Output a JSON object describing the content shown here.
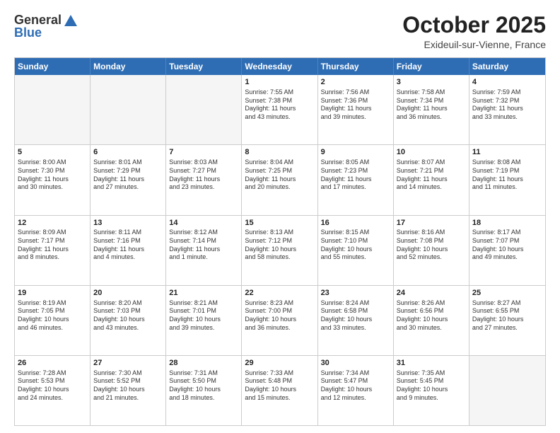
{
  "header": {
    "logo": {
      "line1": "General",
      "line2": "Blue"
    },
    "title": "October 2025",
    "location": "Exideuil-sur-Vienne, France"
  },
  "weekdays": [
    "Sunday",
    "Monday",
    "Tuesday",
    "Wednesday",
    "Thursday",
    "Friday",
    "Saturday"
  ],
  "weeks": [
    [
      {
        "day": "",
        "empty": true,
        "lines": []
      },
      {
        "day": "",
        "empty": true,
        "lines": []
      },
      {
        "day": "",
        "empty": true,
        "lines": []
      },
      {
        "day": "1",
        "empty": false,
        "lines": [
          "Sunrise: 7:55 AM",
          "Sunset: 7:38 PM",
          "Daylight: 11 hours",
          "and 43 minutes."
        ]
      },
      {
        "day": "2",
        "empty": false,
        "lines": [
          "Sunrise: 7:56 AM",
          "Sunset: 7:36 PM",
          "Daylight: 11 hours",
          "and 39 minutes."
        ]
      },
      {
        "day": "3",
        "empty": false,
        "lines": [
          "Sunrise: 7:58 AM",
          "Sunset: 7:34 PM",
          "Daylight: 11 hours",
          "and 36 minutes."
        ]
      },
      {
        "day": "4",
        "empty": false,
        "lines": [
          "Sunrise: 7:59 AM",
          "Sunset: 7:32 PM",
          "Daylight: 11 hours",
          "and 33 minutes."
        ]
      }
    ],
    [
      {
        "day": "5",
        "empty": false,
        "lines": [
          "Sunrise: 8:00 AM",
          "Sunset: 7:30 PM",
          "Daylight: 11 hours",
          "and 30 minutes."
        ]
      },
      {
        "day": "6",
        "empty": false,
        "lines": [
          "Sunrise: 8:01 AM",
          "Sunset: 7:29 PM",
          "Daylight: 11 hours",
          "and 27 minutes."
        ]
      },
      {
        "day": "7",
        "empty": false,
        "lines": [
          "Sunrise: 8:03 AM",
          "Sunset: 7:27 PM",
          "Daylight: 11 hours",
          "and 23 minutes."
        ]
      },
      {
        "day": "8",
        "empty": false,
        "lines": [
          "Sunrise: 8:04 AM",
          "Sunset: 7:25 PM",
          "Daylight: 11 hours",
          "and 20 minutes."
        ]
      },
      {
        "day": "9",
        "empty": false,
        "lines": [
          "Sunrise: 8:05 AM",
          "Sunset: 7:23 PM",
          "Daylight: 11 hours",
          "and 17 minutes."
        ]
      },
      {
        "day": "10",
        "empty": false,
        "lines": [
          "Sunrise: 8:07 AM",
          "Sunset: 7:21 PM",
          "Daylight: 11 hours",
          "and 14 minutes."
        ]
      },
      {
        "day": "11",
        "empty": false,
        "lines": [
          "Sunrise: 8:08 AM",
          "Sunset: 7:19 PM",
          "Daylight: 11 hours",
          "and 11 minutes."
        ]
      }
    ],
    [
      {
        "day": "12",
        "empty": false,
        "lines": [
          "Sunrise: 8:09 AM",
          "Sunset: 7:17 PM",
          "Daylight: 11 hours",
          "and 8 minutes."
        ]
      },
      {
        "day": "13",
        "empty": false,
        "lines": [
          "Sunrise: 8:11 AM",
          "Sunset: 7:16 PM",
          "Daylight: 11 hours",
          "and 4 minutes."
        ]
      },
      {
        "day": "14",
        "empty": false,
        "lines": [
          "Sunrise: 8:12 AM",
          "Sunset: 7:14 PM",
          "Daylight: 11 hours",
          "and 1 minute."
        ]
      },
      {
        "day": "15",
        "empty": false,
        "lines": [
          "Sunrise: 8:13 AM",
          "Sunset: 7:12 PM",
          "Daylight: 10 hours",
          "and 58 minutes."
        ]
      },
      {
        "day": "16",
        "empty": false,
        "lines": [
          "Sunrise: 8:15 AM",
          "Sunset: 7:10 PM",
          "Daylight: 10 hours",
          "and 55 minutes."
        ]
      },
      {
        "day": "17",
        "empty": false,
        "lines": [
          "Sunrise: 8:16 AM",
          "Sunset: 7:08 PM",
          "Daylight: 10 hours",
          "and 52 minutes."
        ]
      },
      {
        "day": "18",
        "empty": false,
        "lines": [
          "Sunrise: 8:17 AM",
          "Sunset: 7:07 PM",
          "Daylight: 10 hours",
          "and 49 minutes."
        ]
      }
    ],
    [
      {
        "day": "19",
        "empty": false,
        "lines": [
          "Sunrise: 8:19 AM",
          "Sunset: 7:05 PM",
          "Daylight: 10 hours",
          "and 46 minutes."
        ]
      },
      {
        "day": "20",
        "empty": false,
        "lines": [
          "Sunrise: 8:20 AM",
          "Sunset: 7:03 PM",
          "Daylight: 10 hours",
          "and 43 minutes."
        ]
      },
      {
        "day": "21",
        "empty": false,
        "lines": [
          "Sunrise: 8:21 AM",
          "Sunset: 7:01 PM",
          "Daylight: 10 hours",
          "and 39 minutes."
        ]
      },
      {
        "day": "22",
        "empty": false,
        "lines": [
          "Sunrise: 8:23 AM",
          "Sunset: 7:00 PM",
          "Daylight: 10 hours",
          "and 36 minutes."
        ]
      },
      {
        "day": "23",
        "empty": false,
        "lines": [
          "Sunrise: 8:24 AM",
          "Sunset: 6:58 PM",
          "Daylight: 10 hours",
          "and 33 minutes."
        ]
      },
      {
        "day": "24",
        "empty": false,
        "lines": [
          "Sunrise: 8:26 AM",
          "Sunset: 6:56 PM",
          "Daylight: 10 hours",
          "and 30 minutes."
        ]
      },
      {
        "day": "25",
        "empty": false,
        "lines": [
          "Sunrise: 8:27 AM",
          "Sunset: 6:55 PM",
          "Daylight: 10 hours",
          "and 27 minutes."
        ]
      }
    ],
    [
      {
        "day": "26",
        "empty": false,
        "lines": [
          "Sunrise: 7:28 AM",
          "Sunset: 5:53 PM",
          "Daylight: 10 hours",
          "and 24 minutes."
        ]
      },
      {
        "day": "27",
        "empty": false,
        "lines": [
          "Sunrise: 7:30 AM",
          "Sunset: 5:52 PM",
          "Daylight: 10 hours",
          "and 21 minutes."
        ]
      },
      {
        "day": "28",
        "empty": false,
        "lines": [
          "Sunrise: 7:31 AM",
          "Sunset: 5:50 PM",
          "Daylight: 10 hours",
          "and 18 minutes."
        ]
      },
      {
        "day": "29",
        "empty": false,
        "lines": [
          "Sunrise: 7:33 AM",
          "Sunset: 5:48 PM",
          "Daylight: 10 hours",
          "and 15 minutes."
        ]
      },
      {
        "day": "30",
        "empty": false,
        "lines": [
          "Sunrise: 7:34 AM",
          "Sunset: 5:47 PM",
          "Daylight: 10 hours",
          "and 12 minutes."
        ]
      },
      {
        "day": "31",
        "empty": false,
        "lines": [
          "Sunrise: 7:35 AM",
          "Sunset: 5:45 PM",
          "Daylight: 10 hours",
          "and 9 minutes."
        ]
      },
      {
        "day": "",
        "empty": true,
        "lines": []
      }
    ]
  ]
}
